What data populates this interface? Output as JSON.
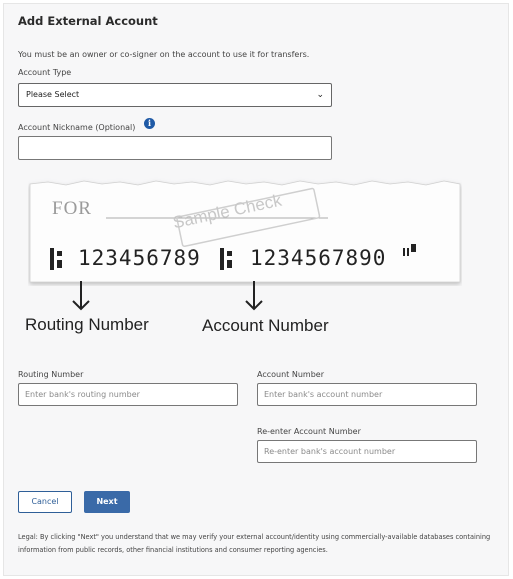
{
  "form": {
    "title": "Add External Account",
    "intro": "You must be an owner or co-signer on the account to use it for transfers.",
    "account_type_label": "Account Type",
    "account_type_value": "Please Select",
    "nickname_label": "Account Nickname (Optional)",
    "nickname_value": ""
  },
  "check": {
    "for_label": "FOR",
    "watermark": "Sample Check",
    "routing_digits": "123456789",
    "account_digits": "1234567890",
    "routing_caption": "Routing Number",
    "account_caption": "Account Number"
  },
  "fields": {
    "routing_label": "Routing Number",
    "routing_placeholder": "Enter bank's routing number",
    "account_label": "Account Number",
    "account_placeholder": "Enter bank's account number",
    "reenter_label": "Re-enter Account Number",
    "reenter_placeholder": "Re-enter bank's account number"
  },
  "buttons": {
    "cancel": "Cancel",
    "next": "Next"
  },
  "legal": "Legal: By clicking \"Next\" you understand that we may verify your external account/identity using commercially-available databases containing information from public records, other financial institutions and consumer reporting agencies.",
  "icons": {
    "info": "info-icon",
    "dropdown": "chevron-down-icon",
    "arrow": "arrow-down-icon"
  },
  "colors": {
    "primary": "#3a6aa8",
    "info": "#1f5aa6"
  }
}
